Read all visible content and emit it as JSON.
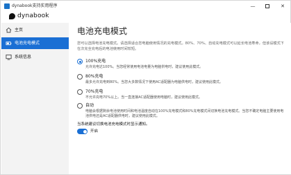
{
  "window": {
    "title": "dynabook支持实用程序",
    "min_glyph": "—",
    "close_glyph": "✕"
  },
  "brand": {
    "name": "dynabook"
  },
  "sidebar": {
    "items": [
      {
        "label": "主页",
        "icon": "home-icon"
      },
      {
        "label": "电池充电模式",
        "icon": "battery-icon",
        "selected": true
      },
      {
        "label": "系统信息",
        "icon": "info-icon"
      }
    ]
  },
  "main": {
    "title": "电池充电模式",
    "description": "您可以选择电池充电模式。请选择适合您电脑使用情况的充电模式。80%、70%、自动充电模式可以延长电池寿命，但该设模式下在次充全充电后的电池使用时间较短。",
    "options": [
      {
        "title": "100%充电",
        "desc": "允许充电达100%。当您经常使用电池电量为电脑供电时，建议使用此模式。",
        "selected": true
      },
      {
        "title": "80%充电",
        "desc": "最多允许充电到80%。当您大多数情况下使用AC适配器为电脑供电时，建议使用此模式。",
        "selected": false
      },
      {
        "title": "70%充电",
        "desc": "不允许充电70%以上。当一直连接AC适配器使用电脑时，建议使用此模式。",
        "selected": false
      },
      {
        "title": "自动",
        "desc": "电脑会根据剩余电池使用时间和电池温度自动在100%充电模式和80%充电模式间切换电池充电模式。当您不确定电脑主要使用电池供电还是AC适配器供电时，建议使用此模式。",
        "selected": false
      }
    ],
    "notify_label": "当系统建议切换电池充电模式时显示通知。",
    "toggle": {
      "label": "开启",
      "on": true
    }
  },
  "colors": {
    "accent": "#1a6fd4",
    "sidebar_bg": "#f3f3f3"
  }
}
